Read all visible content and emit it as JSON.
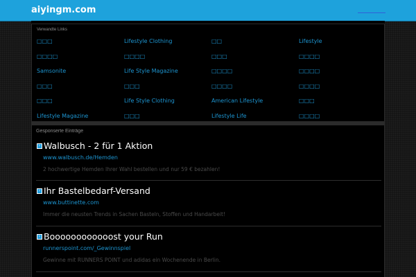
{
  "header": {
    "site_name": "aiyingm.com"
  },
  "related_links": {
    "title": "Verwandte Links",
    "items": [
      "□□□",
      "Lifestyle Clothing",
      "□□",
      "Lifestyle",
      "□□□□",
      "□□□□",
      "□□□",
      "□□□□",
      "Samsonite",
      "Life Style Magazine",
      "□□□□",
      "□□□□",
      "□□□",
      "□□□",
      "□□□□",
      "□□□□",
      "□□□",
      "Life Style Clothing",
      "American Lifestyle",
      "□□□",
      "Lifestyle Magazine",
      "□□□",
      "Lifestyle Life",
      "□□□□"
    ]
  },
  "sponsored": {
    "title": "Gesponserte Einträge",
    "ads": [
      {
        "title": "Walbusch - 2 für 1 Aktion",
        "url": "www.walbusch.de/Hemden",
        "description": "2 hochwertige Hemden Ihrer Wahl bestellen und nur 59 € bezahlen!"
      },
      {
        "title": "Ihr Bastelbedarf-Versand",
        "url": "www.buttinette.com",
        "description": "Immer die neusten Trends in Sachen Basteln, Stoffen und Handarbeit!"
      },
      {
        "title": "Boooooooooooost your Run",
        "url": "runnerspoint.com/_Gewinnspiel",
        "description": "Gewinne mit RUNNERS POINT und adidas ein Wochenende in Berlin."
      }
    ]
  }
}
